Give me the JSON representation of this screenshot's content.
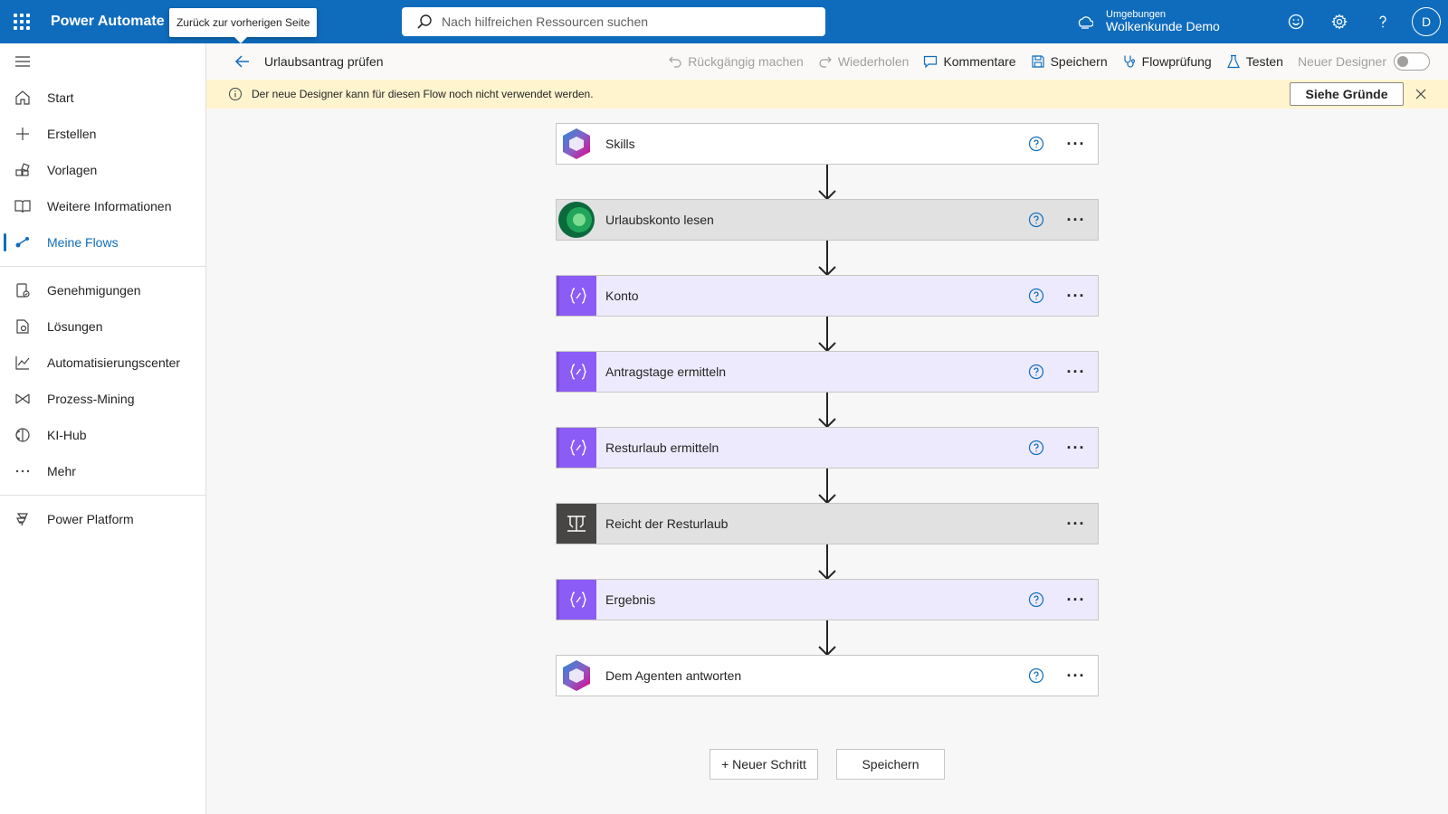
{
  "topbar": {
    "app_title": "Power Automate",
    "tooltip": "Zurück zur vorherigen Seite",
    "search_placeholder": "Nach hilfreichen Ressourcen suchen",
    "env_label": "Umgebungen",
    "env_name": "Wolkenkunde Demo",
    "avatar_initial": "D",
    "brand_color": "#0f6cbd"
  },
  "sidebar": {
    "items": [
      {
        "label": "Start",
        "icon": "home-icon"
      },
      {
        "label": "Erstellen",
        "icon": "plus-icon"
      },
      {
        "label": "Vorlagen",
        "icon": "templates-icon"
      },
      {
        "label": "Weitere Informationen",
        "icon": "book-icon"
      },
      {
        "label": "Meine Flows",
        "icon": "flows-icon",
        "active": true
      }
    ],
    "items2": [
      {
        "label": "Genehmigungen",
        "icon": "approvals-icon"
      },
      {
        "label": "Lösungen",
        "icon": "solutions-icon"
      },
      {
        "label": "Automatisierungscenter",
        "icon": "chart-icon"
      },
      {
        "label": "Prozess-Mining",
        "icon": "process-mining-icon"
      },
      {
        "label": "KI-Hub",
        "icon": "ai-hub-icon"
      },
      {
        "label": "Mehr",
        "icon": "more-icon"
      }
    ],
    "items3": [
      {
        "label": "Power Platform",
        "icon": "power-platform-icon"
      }
    ]
  },
  "cmdbar": {
    "flow_name": "Urlaubsantrag prüfen",
    "undo": "Rückgängig machen",
    "redo": "Wiederholen",
    "comments": "Kommentare",
    "save": "Speichern",
    "flow_check": "Flowprüfung",
    "test": "Testen",
    "new_designer": "Neuer Designer"
  },
  "banner": {
    "message": "Der neue Designer kann für diesen Flow noch nicht verwendet werden.",
    "button": "Siehe Gründe"
  },
  "steps": [
    {
      "title": "Skills",
      "icon": "copilot-icon",
      "style": "white",
      "help": true
    },
    {
      "title": "Urlaubskonto lesen",
      "icon": "dataverse-icon",
      "style": "grey",
      "help": true
    },
    {
      "title": "Konto",
      "icon": "variable-icon",
      "style": "purple",
      "help": true
    },
    {
      "title": "Antragstage ermitteln",
      "icon": "variable-icon",
      "style": "purple",
      "help": true
    },
    {
      "title": "Resturlaub ermitteln",
      "icon": "variable-icon",
      "style": "purple",
      "help": true
    },
    {
      "title": "Reicht der Resturlaub",
      "icon": "condition-icon",
      "style": "grey",
      "help": false
    },
    {
      "title": "Ergebnis",
      "icon": "variable-icon",
      "style": "purple",
      "help": true
    },
    {
      "title": "Dem Agenten antworten",
      "icon": "copilot-icon",
      "style": "white",
      "help": true
    }
  ],
  "footer": {
    "new_step": "+ Neuer Schritt",
    "save": "Speichern"
  }
}
